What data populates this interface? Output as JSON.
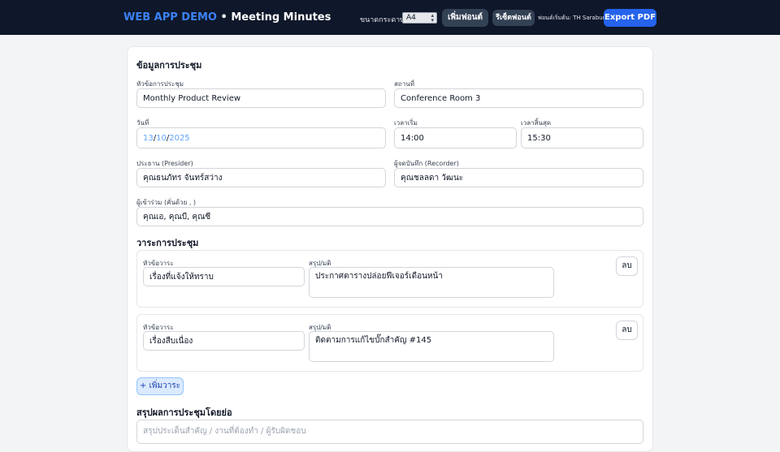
{
  "header": {
    "brand": "WEB APP DEMO",
    "separator": "•",
    "title": "Meeting Minutes",
    "paper_size_label": "ขนาดกระดาษ",
    "paper_size_value": "A4",
    "add_font_label": "เพิ่มฟอนต์",
    "reset_font_label": "รีเซ็ตฟอนต์",
    "default_font_text": "ฟอนต์เริ่มต้น: TH Sarabun",
    "export_label": "Export PDF"
  },
  "meeting_info": {
    "section_title": "ข้อมูลการประชุม",
    "topic_label": "หัวข้อการประชุม",
    "topic_value": "Monthly Product Review",
    "location_label": "สถานที่",
    "location_value": "Conference Room 3",
    "date_label": "วันที่",
    "date_day": "13",
    "date_month": "10",
    "date_year": "2025",
    "start_label": "เวลาเริ่ม",
    "start_value": "14:00",
    "end_label": "เวลาสิ้นสุด",
    "end_value": "15:30",
    "president_label": "ประธาน (Presider)",
    "president_value": "คุณธนภัทร จันทร์สว่าง",
    "recorder_label": "ผู้จดบันทึก (Recorder)",
    "recorder_value": "คุณชลลดา วัฒนะ",
    "attendees_label": "ผู้เข้าร่วม (คั่นด้วย , )",
    "attendees_value": "คุณเอ, คุณบี, คุณซี"
  },
  "agenda": {
    "section_title": "วาระการประชุม",
    "topic_label": "หัวข้อวาระ",
    "summary_label": "สรุป/มติ",
    "delete_label": "ลบ",
    "items": [
      {
        "topic": "เรื่องที่แจ้งให้ทราบ",
        "summary": "ประกาศตารางปล่อยฟีเจอร์เดือนหน้า"
      },
      {
        "topic": "เรื่องสืบเนื่อง",
        "summary": "ติดตามการแก้ไขบั๊กสำคัญ #145"
      }
    ],
    "add_label": "+ เพิ่มวาระ"
  },
  "summary": {
    "section_title": "สรุปผลการประชุมโดยย่อ",
    "placeholder": "สรุปประเด็นสำคัญ / งานที่ต้องทำ / ผู้รับผิดชอบ"
  }
}
